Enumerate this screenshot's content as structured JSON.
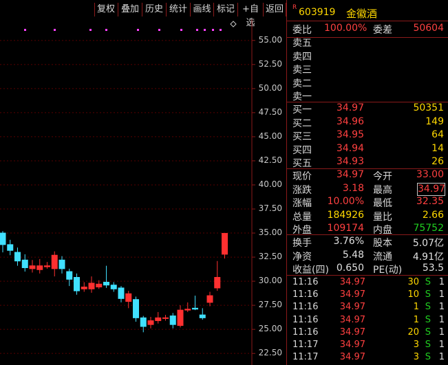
{
  "toolbar": {
    "items": [
      "复权",
      "叠加",
      "历史",
      "统计",
      "画线",
      "标记",
      "+自选",
      "返回"
    ]
  },
  "stock": {
    "flag": "R",
    "code": "603919",
    "name": "金徽酒"
  },
  "header_stats": {
    "weibi_label": "委比",
    "weibi_value": "100.00%",
    "weicha_label": "委差",
    "weicha_value": "50604"
  },
  "sell_orders": [
    {
      "label": "卖五",
      "price": "",
      "volume": ""
    },
    {
      "label": "卖四",
      "price": "",
      "volume": ""
    },
    {
      "label": "卖三",
      "price": "",
      "volume": ""
    },
    {
      "label": "卖二",
      "price": "",
      "volume": ""
    },
    {
      "label": "卖一",
      "price": "",
      "volume": ""
    }
  ],
  "buy_orders": [
    {
      "label": "买一",
      "price": "34.97",
      "volume": "50351"
    },
    {
      "label": "买二",
      "price": "34.96",
      "volume": "149"
    },
    {
      "label": "买三",
      "price": "34.95",
      "volume": "64"
    },
    {
      "label": "买四",
      "price": "34.94",
      "volume": "14"
    },
    {
      "label": "买五",
      "price": "34.93",
      "volume": "26"
    }
  ],
  "quote": {
    "rows": [
      {
        "l1": "现价",
        "v1": "34.97",
        "l2": "今开",
        "v2": "33.00"
      },
      {
        "l1": "涨跌",
        "v1": "3.18",
        "l2": "最高",
        "v2": "34.97"
      },
      {
        "l1": "涨幅",
        "v1": "10.00%",
        "l2": "最低",
        "v2": "32.35"
      },
      {
        "l1": "总量",
        "v1": "184926",
        "l2": "量比",
        "v2": "2.66"
      },
      {
        "l1": "外盘",
        "v1": "109174",
        "l2": "内盘",
        "v2": "75752"
      }
    ]
  },
  "fundamentals": {
    "rows": [
      {
        "l1": "换手",
        "v1": "3.76%",
        "l2": "股本",
        "v2": "5.07亿"
      },
      {
        "l1": "净资",
        "v1": "5.48",
        "l2": "流通",
        "v2": "4.91亿"
      },
      {
        "l1": "收益(四)",
        "v1": "0.650",
        "l2": "PE(动)",
        "v2": "53.5"
      }
    ]
  },
  "trades": [
    {
      "time": "11:16",
      "price": "34.97",
      "vol": "30",
      "side": "S",
      "count": "1"
    },
    {
      "time": "11:16",
      "price": "34.97",
      "vol": "10",
      "side": "S",
      "count": "1"
    },
    {
      "time": "11:16",
      "price": "34.97",
      "vol": "1",
      "side": "S",
      "count": "1"
    },
    {
      "time": "11:16",
      "price": "34.97",
      "vol": "1",
      "side": "S",
      "count": "1"
    },
    {
      "time": "11:16",
      "price": "34.97",
      "vol": "20",
      "side": "S",
      "count": "1"
    },
    {
      "time": "11:17",
      "price": "34.97",
      "vol": "3",
      "side": "S",
      "count": "1"
    },
    {
      "time": "11:17",
      "price": "34.97",
      "vol": "3",
      "side": "S",
      "count": "1"
    }
  ],
  "chart_data": {
    "type": "candlestick",
    "y_ticks": [
      "55.00",
      "52.50",
      "50.00",
      "47.50",
      "45.00",
      "42.50",
      "40.00",
      "37.50",
      "35.00",
      "32.50",
      "30.00",
      "27.50",
      "25.00",
      "22.50"
    ],
    "ylim": [
      21.3,
      57.2
    ],
    "grid": "dashed horizontal",
    "candles": [
      {
        "o": 35.0,
        "c": 33.8,
        "h": 35.2,
        "l": 33.0
      },
      {
        "o": 33.8,
        "c": 33.2,
        "h": 34.3,
        "l": 32.7
      },
      {
        "o": 33.0,
        "c": 32.1,
        "h": 33.5,
        "l": 31.6
      },
      {
        "o": 32.2,
        "c": 31.4,
        "h": 32.8,
        "l": 31.0
      },
      {
        "o": 31.3,
        "c": 31.6,
        "h": 32.2,
        "l": 30.9
      },
      {
        "o": 31.2,
        "c": 31.6,
        "h": 32.3,
        "l": 30.8
      },
      {
        "o": 31.5,
        "c": 31.6,
        "h": 32.0,
        "l": 31.3
      },
      {
        "o": 31.3,
        "c": 32.7,
        "h": 33.1,
        "l": 30.5
      },
      {
        "o": 32.2,
        "c": 31.3,
        "h": 32.6,
        "l": 30.8
      },
      {
        "o": 31.0,
        "c": 30.2,
        "h": 31.3,
        "l": 29.5
      },
      {
        "o": 30.4,
        "c": 29.0,
        "h": 30.8,
        "l": 28.6
      },
      {
        "o": 29.2,
        "c": 29.4,
        "h": 29.9,
        "l": 28.9
      },
      {
        "o": 29.2,
        "c": 29.8,
        "h": 30.5,
        "l": 28.8
      },
      {
        "o": 29.4,
        "c": 29.7,
        "h": 30.1,
        "l": 29.2
      },
      {
        "o": 29.9,
        "c": 29.6,
        "h": 31.6,
        "l": 29.3
      },
      {
        "o": 29.6,
        "c": 29.2,
        "h": 29.9,
        "l": 28.9
      },
      {
        "o": 29.3,
        "c": 28.2,
        "h": 29.5,
        "l": 27.8
      },
      {
        "o": 27.9,
        "c": 28.7,
        "h": 29.0,
        "l": 27.2
      },
      {
        "o": 28.1,
        "c": 26.2,
        "h": 28.4,
        "l": 25.8
      },
      {
        "o": 26.2,
        "c": 25.3,
        "h": 26.4,
        "l": 24.7
      },
      {
        "o": 25.5,
        "c": 25.9,
        "h": 26.3,
        "l": 25.1
      },
      {
        "o": 25.9,
        "c": 26.2,
        "h": 26.8,
        "l": 25.6
      },
      {
        "o": 26.2,
        "c": 26.2,
        "h": 26.5,
        "l": 25.9
      },
      {
        "o": 26.4,
        "c": 25.5,
        "h": 26.7,
        "l": 25.1
      },
      {
        "o": 25.4,
        "c": 27.0,
        "h": 27.5,
        "l": 25.2
      },
      {
        "o": 27.0,
        "c": 27.1,
        "h": 27.8,
        "l": 26.8
      },
      {
        "o": 27.2,
        "c": 27.1,
        "h": 28.5,
        "l": 27.0
      },
      {
        "o": 26.5,
        "c": 26.2,
        "h": 27.2,
        "l": 26.0
      },
      {
        "o": 27.8,
        "c": 28.5,
        "h": 28.9,
        "l": 27.4
      },
      {
        "o": 29.3,
        "c": 30.4,
        "h": 32.1,
        "l": 29.0
      },
      {
        "o": 32.8,
        "c": 34.97,
        "h": 34.97,
        "l": 32.35
      }
    ]
  }
}
